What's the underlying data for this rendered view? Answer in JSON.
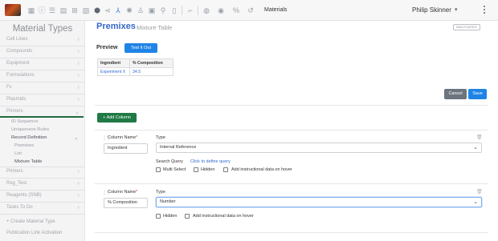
{
  "topbar": {
    "icons": [
      "app-logo",
      "dashboard-icon",
      "info-icon",
      "list-icon",
      "table-icon",
      "grid-icon",
      "document-icon",
      "flask-icon",
      "share-icon",
      "hierarchy-icon",
      "settings-icon",
      "group-icon",
      "image-icon",
      "tools-icon",
      "file-icon",
      "pipeline-icon",
      "location-icon",
      "visibility-icon",
      "percent-icon",
      "history-icon"
    ],
    "section_label": "Materials",
    "user_name": "Philip Skinner",
    "user_caret": "▾"
  },
  "sidebar": {
    "title": "Material Types",
    "items": [
      {
        "label": "Cell Lines"
      },
      {
        "label": "Compounds"
      },
      {
        "label": "Equipment"
      },
      {
        "label": "Formulations"
      },
      {
        "label": "Fv"
      },
      {
        "label": "Plasmids"
      },
      {
        "label": "Primers"
      },
      {
        "label": "Primers"
      },
      {
        "label": "Rxg_Test"
      },
      {
        "label": "Reagents (SNB)"
      },
      {
        "label": "Tasks To Do"
      }
    ],
    "sub_items": {
      "id_sequence": "ID Sequence",
      "uniqueness_rules": "Uniqueness Rules",
      "record_definition": "Record Definition",
      "premixes": "Premixes",
      "list": "List",
      "mixture_table": "Mixture Table"
    },
    "create_link": "+ Create Material Type",
    "partial_link": "Publication Link Activation"
  },
  "header": {
    "title": "Premixes",
    "subtitle": "Mixture Table",
    "badge": "INACTIVATED"
  },
  "preview": {
    "label": "Preview",
    "test_button": "Test It Out",
    "columns": [
      "Ingredient",
      "% Composition"
    ],
    "rows": [
      [
        "Experiment X",
        "34.5"
      ]
    ]
  },
  "actions": {
    "cancel": "Cancel",
    "save": "Save",
    "add_column": "+ Add Column"
  },
  "columns": [
    {
      "name_label": "Column Name",
      "required_mark": "*",
      "name_value": "Ingredient",
      "type_label": "Type",
      "type_value": "Internal Reference",
      "search_query_label": "Search Query",
      "search_query_link": "Click to define query",
      "options": [
        "Multi Select",
        "Hidden",
        "Add instructional data on hover"
      ]
    },
    {
      "name_label": "Column Name",
      "required_mark": "*",
      "name_value": "% Composition",
      "type_label": "Type",
      "type_value": "Number",
      "options": [
        "Hidden",
        "Add instructional data on hover"
      ]
    }
  ],
  "colors": {
    "primary_blue": "#1f84e6",
    "title_blue": "#3469c9",
    "add_green": "#1f7a45",
    "cancel_gray": "#6c757d",
    "sidebar_bg": "#f4f4f5"
  }
}
